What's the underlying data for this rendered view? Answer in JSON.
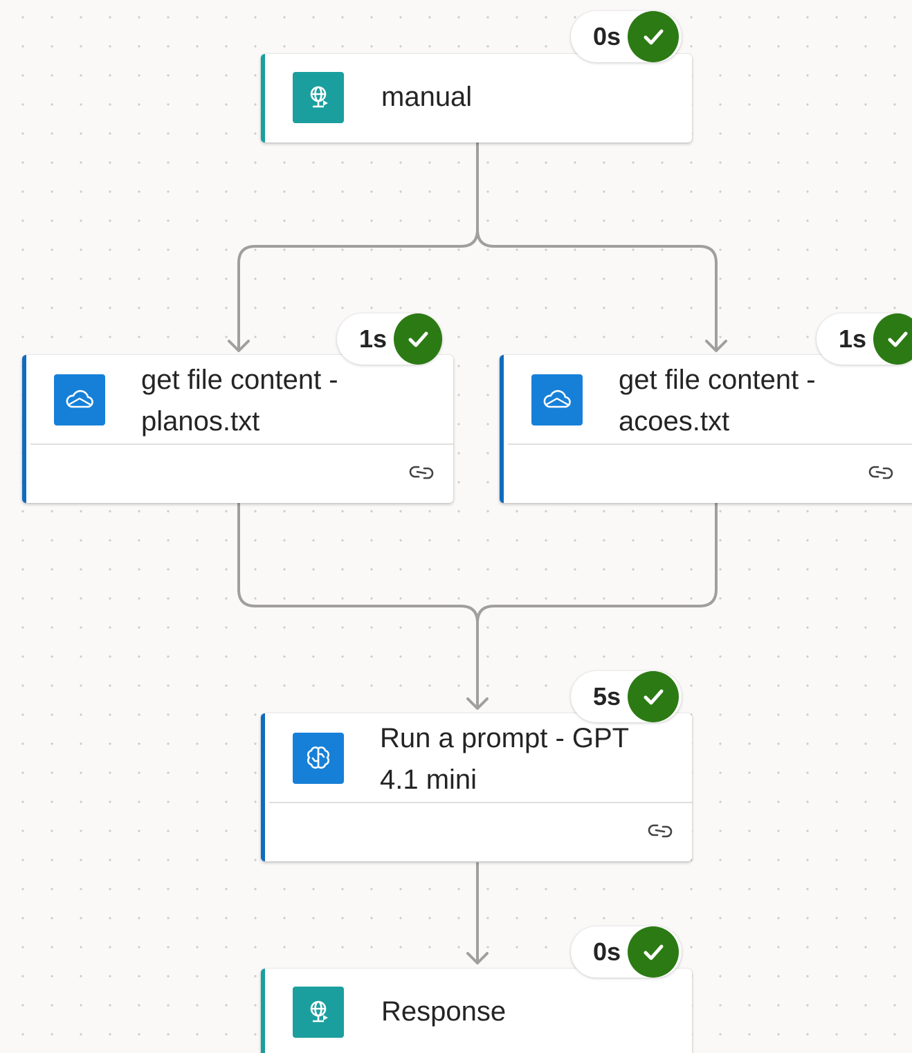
{
  "colors": {
    "accent": "#0f6cbd",
    "success": "#2c7a14",
    "icon_teal": "#1b9e9e",
    "icon_blue": "#1680d8",
    "connector": "#a19f9d"
  },
  "nodes": {
    "manual": {
      "title": "manual",
      "icon": "http-request-globe-icon",
      "duration": "0s",
      "status": "succeeded"
    },
    "get_planos": {
      "title_line1": "get file content -",
      "title_line2": "planos.txt",
      "icon": "onedrive-cloud-icon",
      "duration": "1s",
      "status": "succeeded"
    },
    "get_acoes": {
      "title_line1": "get file content -",
      "title_line2": "acoes.txt",
      "icon": "onedrive-cloud-icon",
      "duration": "1s",
      "status": "succeeded"
    },
    "run_prompt": {
      "title_line1": "Run a prompt - GPT",
      "title_line2": "4.1 mini",
      "icon": "ai-brain-icon",
      "duration": "5s",
      "status": "succeeded"
    },
    "response": {
      "title": "Response",
      "icon": "http-request-globe-icon",
      "duration": "0s",
      "status": "succeeded"
    }
  }
}
